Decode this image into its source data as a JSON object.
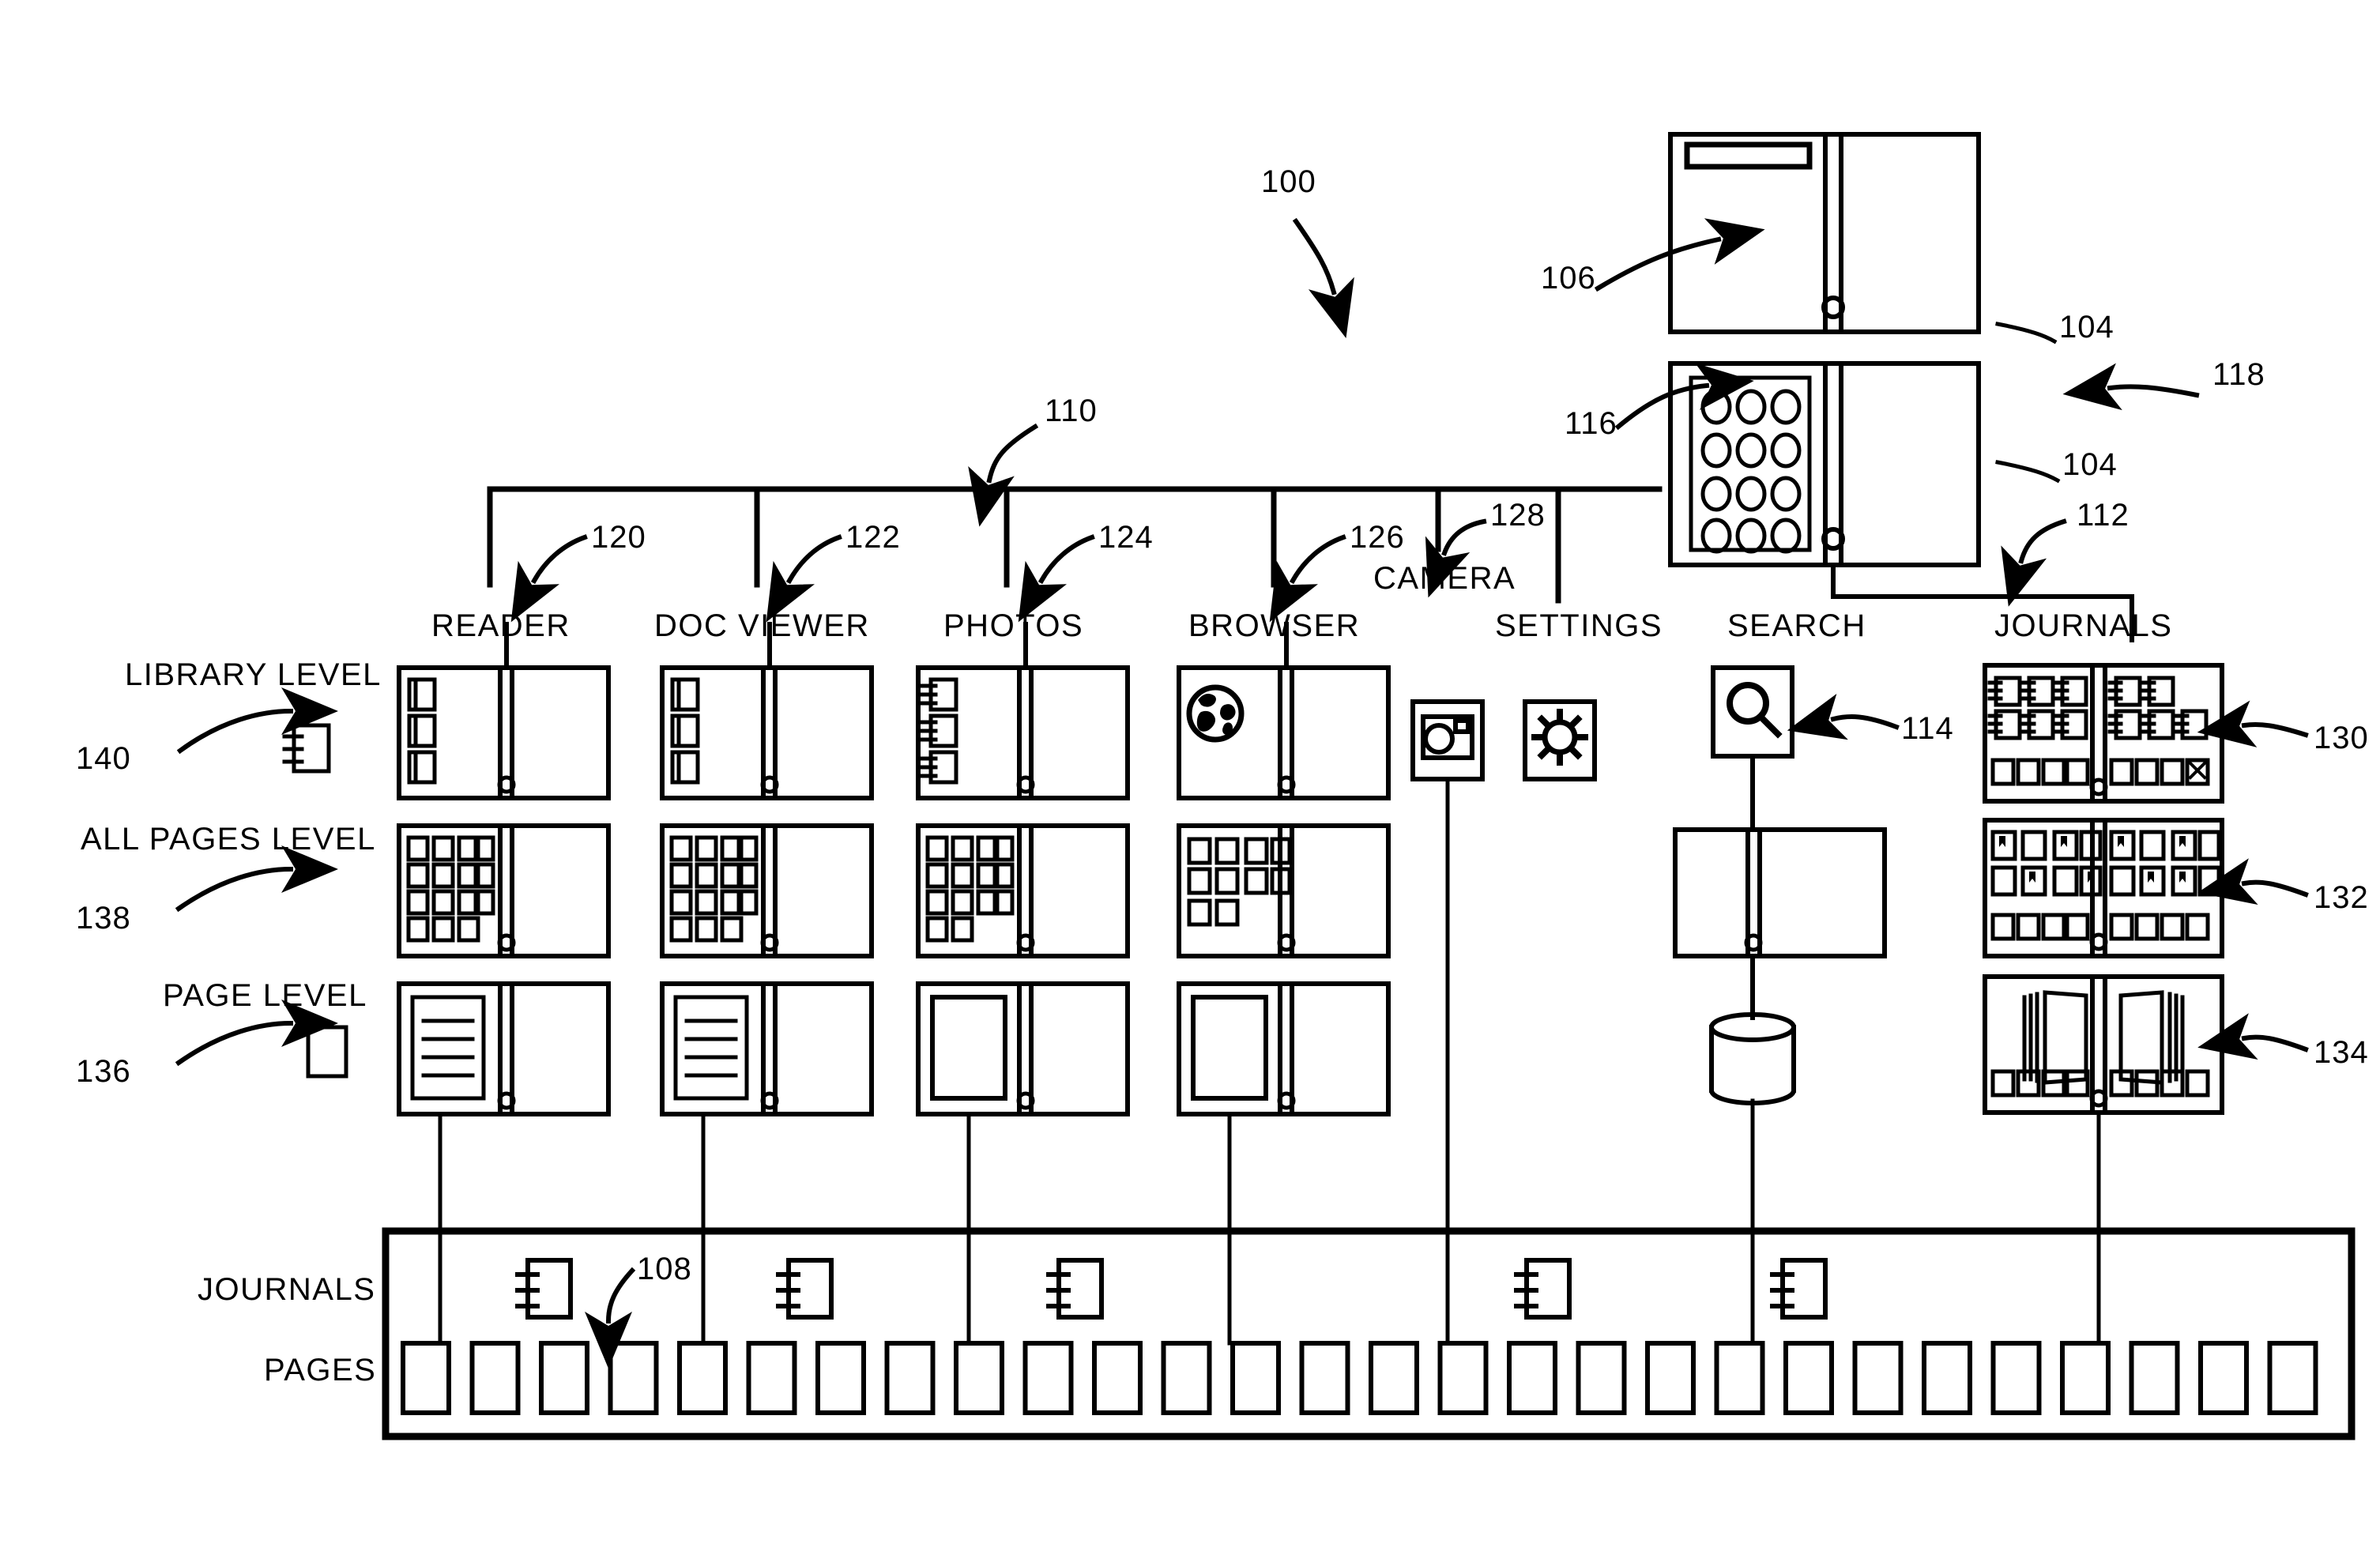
{
  "figure": {
    "title": "Application hierarchy block diagram",
    "system_ref": "100",
    "stroke_color": "#000000",
    "background_color": "#ffffff"
  },
  "devices": [
    {
      "ref_body": "104",
      "ref_callout": "106",
      "kind": "dual-panel-device-with-title-bar",
      "name": "device-closed-view"
    },
    {
      "ref_body": "104",
      "ref_callout": "116",
      "ref_group": "118",
      "ref_link": "112",
      "kind": "dual-panel-device-with-icon-grid",
      "name": "device-home-screen",
      "icon_grid": {
        "rows": 4,
        "cols": 3
      }
    }
  ],
  "bus": {
    "ref": "110",
    "name": "application-bus"
  },
  "columns": [
    {
      "label": "READER",
      "ref": "120"
    },
    {
      "label": "DOC VIEWER",
      "ref": "122"
    },
    {
      "label": "PHOTOS",
      "ref": "124"
    },
    {
      "label": "BROWSER",
      "ref": "126"
    },
    {
      "label": "CAMERA",
      "ref": "128"
    },
    {
      "label": "SETTINGS",
      "ref": ""
    },
    {
      "label": "SEARCH",
      "ref": "114"
    },
    {
      "label": "JOURNALS",
      "ref": "112"
    }
  ],
  "rows": [
    {
      "label": "LIBRARY LEVEL",
      "ref": "140",
      "icon": "notebook-icon"
    },
    {
      "label": "ALL PAGES LEVEL",
      "ref": "138",
      "icon": ""
    },
    {
      "label": "PAGE LEVEL",
      "ref": "136",
      "icon": "page-icon"
    }
  ],
  "journal_views": [
    {
      "ref": "130",
      "name": "journal-library-view"
    },
    {
      "ref": "132",
      "name": "journal-all-pages-view"
    },
    {
      "ref": "134",
      "name": "journal-page-view"
    }
  ],
  "search_column": {
    "icon_ref": "114",
    "icon": "magnifier-icon",
    "store": "database-cylinder"
  },
  "bottom_panel": {
    "journals_label": "JOURNALS",
    "pages_label": "PAGES",
    "journal_item_ref": "108",
    "journal_count": 5,
    "page_count": 28
  },
  "reference_numerals": [
    "100",
    "104",
    "106",
    "108",
    "110",
    "112",
    "114",
    "116",
    "118",
    "120",
    "122",
    "124",
    "126",
    "128",
    "130",
    "132",
    "134",
    "136",
    "138",
    "140"
  ]
}
